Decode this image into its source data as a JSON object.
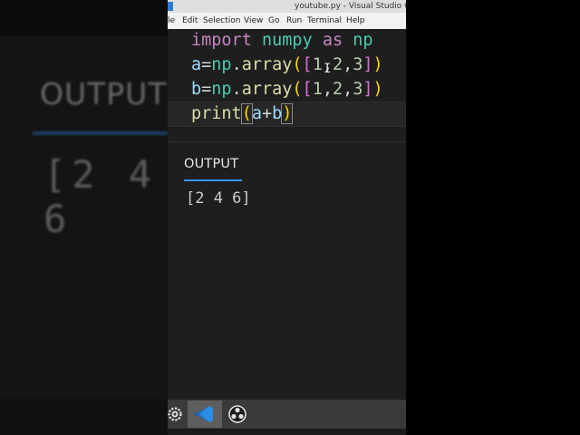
{
  "window": {
    "title": "youtube.py - Visual Studio Cod"
  },
  "menu": {
    "items": [
      "le",
      "Edit",
      "Selection",
      "View",
      "Go",
      "Run",
      "Terminal",
      "Help"
    ]
  },
  "editor": {
    "line1": {
      "kw": "import",
      "mod": "numpy",
      "as": "as",
      "alias": "np"
    },
    "line2": {
      "var": "a",
      "mod": "np",
      "fn": "array",
      "n1": "1",
      "n2": "2",
      "n3": "3"
    },
    "line3": {
      "var": "b",
      "mod": "np",
      "fn": "array",
      "n1": "1",
      "n2": "2",
      "n3": "3"
    },
    "line4": {
      "fn": "print",
      "a": "a",
      "b": "b"
    }
  },
  "panel": {
    "tab_label": "OUTPUT",
    "output": "[2 4 6]"
  },
  "background_ghost": {
    "label": "OUTPUT",
    "result": "[2 4 6"
  },
  "colors": {
    "editor_bg": "#1e1e1e",
    "accent": "#3794ff",
    "keyword": "#c586c0",
    "module": "#4ec9b0",
    "function": "#dcdcaa",
    "number": "#b5cea8",
    "variable": "#9cdcfe"
  },
  "icons": {
    "start": "gear-icon",
    "vscode": "vscode-icon",
    "obs": "obs-icon"
  }
}
